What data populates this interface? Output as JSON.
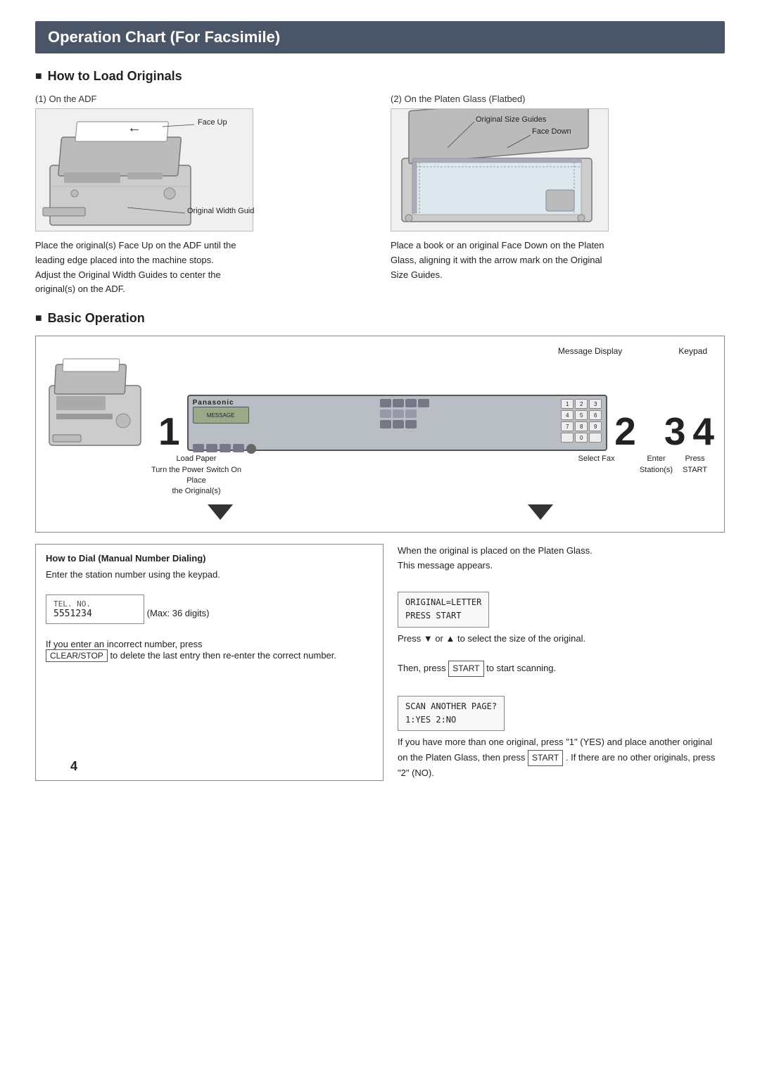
{
  "page": {
    "title": "Operation Chart (For Facsimile)",
    "page_number": "4"
  },
  "sections": {
    "how_to_load": {
      "title": "How to Load Originals",
      "col1": {
        "label": "(1) On the ADF",
        "labels": {
          "face_up": "Face Up",
          "width_guide": "Original Width Guide"
        },
        "description": [
          "Place the original(s) Face Up on the ADF until the leading edge placed into the machine stops.",
          "Adjust the Original Width Guides to center the original(s) on the ADF."
        ]
      },
      "col2": {
        "label": "(2) On the Platen Glass (Flatbed)",
        "labels": {
          "size_guides": "Original Size Guides",
          "face_down": "Face Down"
        },
        "description": [
          "Place a book or an original Face Down on the Platen Glass, aligning it with the arrow mark on the Original Size Guides."
        ]
      }
    },
    "basic_operation": {
      "title": "Basic Operation",
      "header_labels": [
        "Message Display",
        "Keypad"
      ],
      "panel_brand": "Panasonic",
      "steps": [
        {
          "number": "1",
          "lines": [
            "Load Paper",
            "Turn the Power Switch On",
            "Place",
            "the Original(s)"
          ]
        },
        {
          "number": "2",
          "lines": [
            "Select Fax"
          ]
        },
        {
          "number": "3",
          "lines": [
            "Enter",
            "Station(s)"
          ]
        },
        {
          "number": "4",
          "lines": [
            "Press",
            "START"
          ]
        }
      ]
    },
    "how_to_dial": {
      "title": "How to Dial (Manual Number Dialing)",
      "text1": "Enter the station number using the keypad.",
      "tel_label": "TEL. NO.",
      "tel_number": "5551234",
      "max_digits": "(Max: 36 digits)",
      "text2": "If you enter an incorrect number, press",
      "clearstop": "CLEAR/STOP",
      "text3": "to delete the last entry then re-enter the correct number."
    },
    "platen_glass_note": {
      "text1": "When  the original is placed on the Platen Glass.",
      "text2": "This message appears.",
      "msg1_line1": "ORIGINAL=LETTER",
      "msg1_line2": "PRESS START",
      "text3": "Press ▼ or ▲ to select the size of the original.",
      "text4": "Then, press",
      "start1": "START",
      "text4b": "to start scanning.",
      "msg2_line1": "SCAN ANOTHER PAGE?",
      "msg2_line2": "1:YES 2:NO",
      "text5": "If you have more than one original,  press \"1\" (YES) and place another original on the Platen Glass, then press",
      "start2": "START",
      "text5b": ". If there are no other originals, press \"2\" (NO)."
    }
  }
}
